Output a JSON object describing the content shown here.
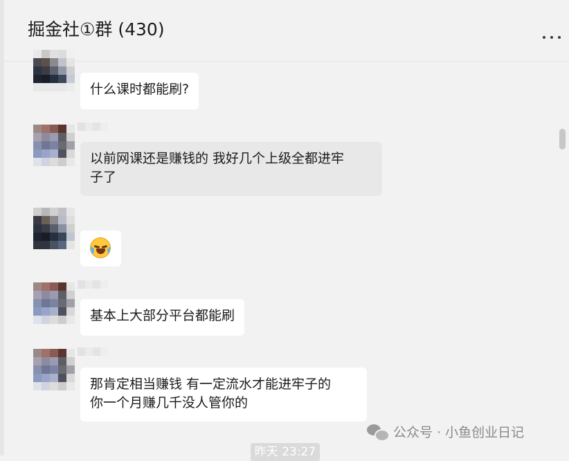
{
  "chat": {
    "title": "掘金社①群 (430)",
    "more_icon": "more-horizontal-icon"
  },
  "messages": [
    {
      "text": "什么课时都能刷?",
      "style": "white"
    },
    {
      "text_line1": "以前网课还是赚钱的 我好几个上级全都进牢",
      "text_line2": "子了",
      "style": "gray"
    },
    {
      "emoji": "crying-laughing-emoji",
      "style": "white"
    },
    {
      "text": "基本上大部分平台都能刷",
      "style": "white"
    },
    {
      "text_line1": "那肯定相当赚钱 有一定流水才能进牢子的",
      "text_line2": "你一个月赚几千没人管你的",
      "style": "white"
    }
  ],
  "watermark": {
    "icon": "wechat-icon",
    "text": "公众号 · 小鱼创业日记"
  },
  "timestamp": "昨天 23:27",
  "colors": {
    "background": "#f2f2f2",
    "bubble_white": "#ffffff",
    "bubble_gray": "#e8e8e8"
  }
}
